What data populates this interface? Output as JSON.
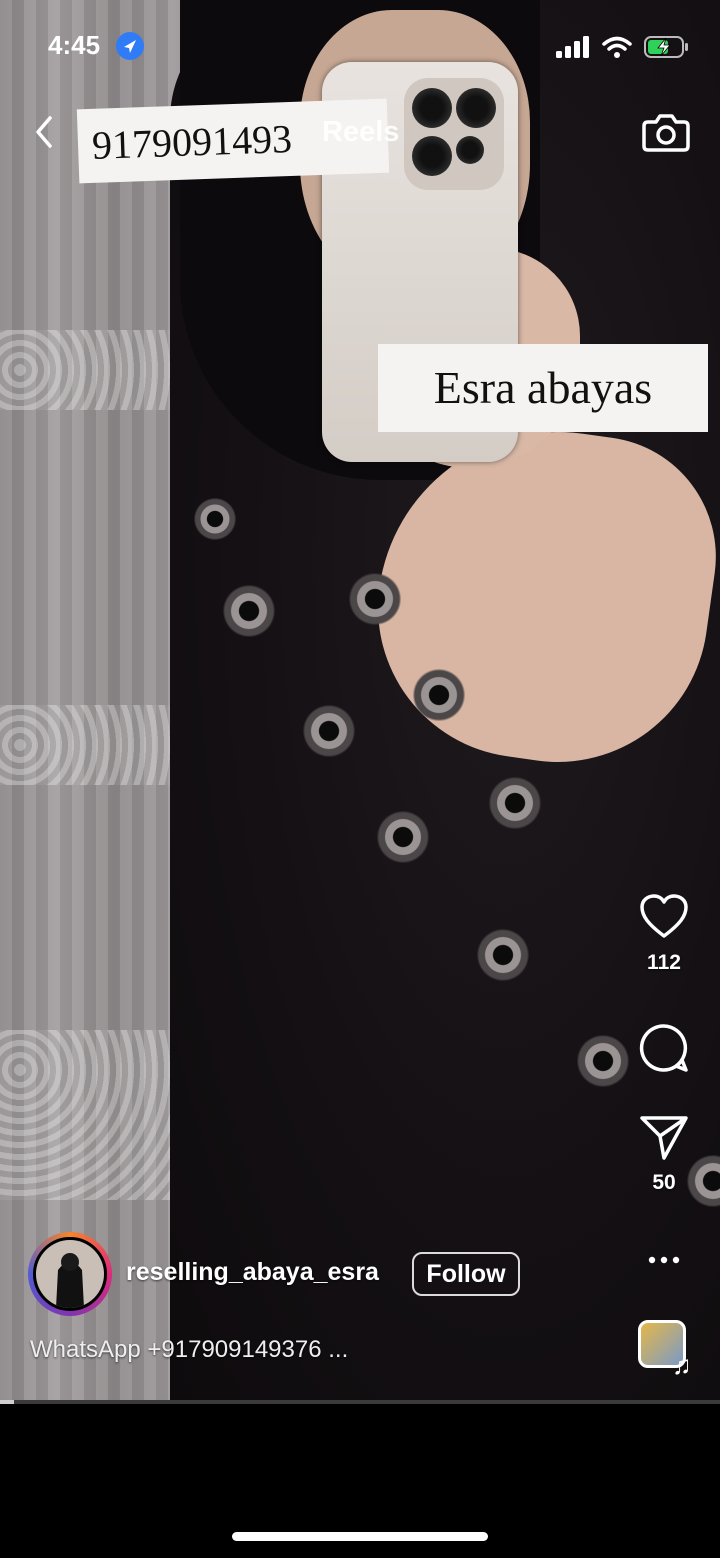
{
  "status_bar": {
    "time": "4:45",
    "location_icon": "location-arrow-icon",
    "signal_icon": "cellular-signal-icon",
    "wifi_icon": "wifi-icon",
    "battery_icon": "battery-charging-icon",
    "battery_color": "#30d158"
  },
  "header": {
    "back_icon": "chevron-left-icon",
    "title": "Reels",
    "camera_icon": "camera-icon"
  },
  "overlays": {
    "phone_number": "9179091493",
    "brand": "Esra abayas"
  },
  "actions": {
    "like_icon": "heart-icon",
    "like_count": "112",
    "comment_icon": "comment-icon",
    "share_icon": "send-icon",
    "share_count": "50",
    "more_icon": "more-horizontal-icon"
  },
  "post": {
    "username": "reselling_abaya_esra",
    "follow_label": "Follow",
    "caption": "WhatsApp +917909149376 ..."
  },
  "music": {
    "thumb_icon": "audio-thumbnail-icon",
    "note_icon": "music-note-icon"
  },
  "progress": {
    "fraction": 0.02
  },
  "colors": {
    "accent_blue": "#2f7cf6",
    "story_ring_start": "#f58529",
    "story_ring_end": "#8134af"
  }
}
